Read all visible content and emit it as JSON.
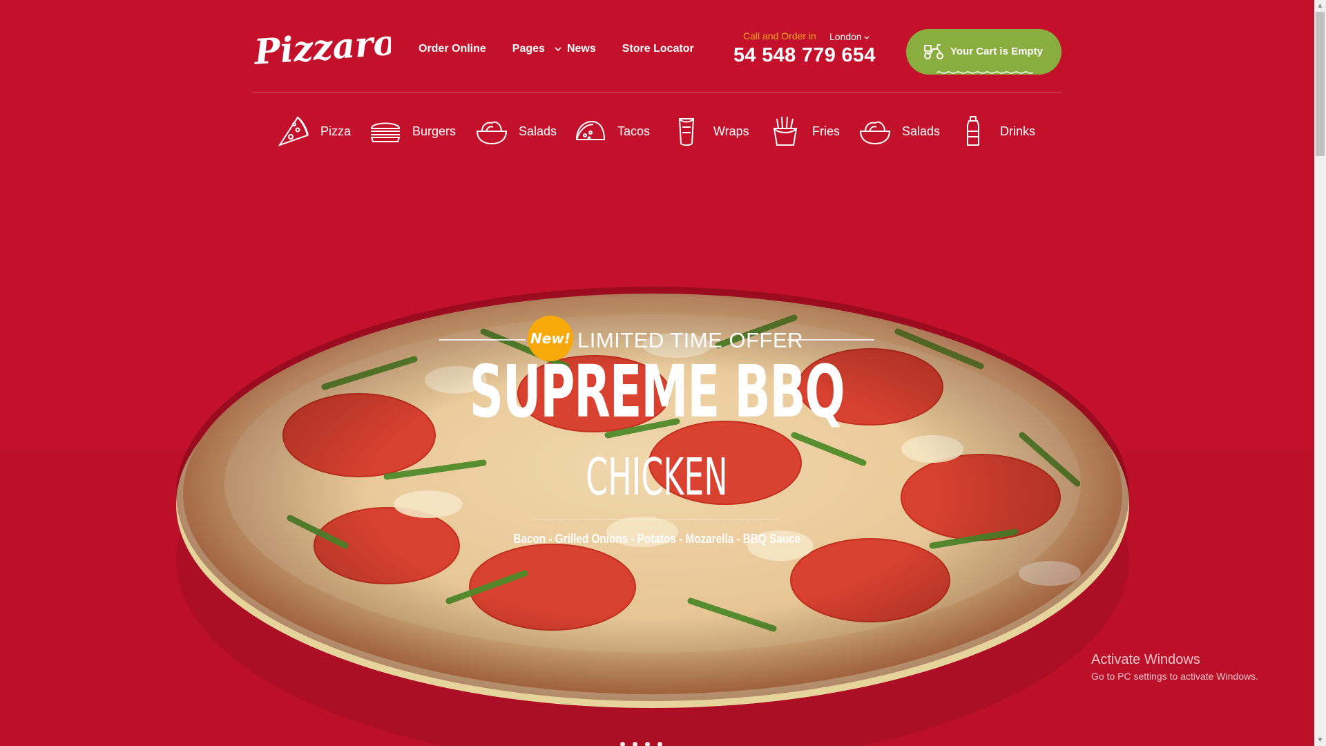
{
  "brand": {
    "logo_text": "Pizzaro"
  },
  "nav": [
    {
      "label": "Order Online"
    },
    {
      "label": "Pages"
    },
    {
      "label": "News"
    },
    {
      "label": "Store Locator"
    }
  ],
  "contact": {
    "call_label": "Call and Order in",
    "city": "London",
    "phone": "54 548 779 654"
  },
  "cart": {
    "label": "Your Cart is Empty"
  },
  "categories": [
    {
      "label": "Pizza",
      "icon": "pizza-slice-icon"
    },
    {
      "label": "Burgers",
      "icon": "burger-icon"
    },
    {
      "label": "Salads",
      "icon": "salad-bowl-icon"
    },
    {
      "label": "Tacos",
      "icon": "taco-icon"
    },
    {
      "label": "Wraps",
      "icon": "wrap-icon"
    },
    {
      "label": "Fries",
      "icon": "fries-icon"
    },
    {
      "label": "Salads",
      "icon": "salad-bowl-icon"
    },
    {
      "label": "Drinks",
      "icon": "drink-bottle-icon"
    }
  ],
  "hero": {
    "badge": "New!",
    "offer": "LIMITED TIME OFFER",
    "title": "SUPREME BBQ",
    "subtitle": "CHICKEN",
    "ingredients": "Bacon - Grilled Onions - Potatos - Mozarella - BBQ Sauce",
    "slides": 4
  },
  "watermark": {
    "title": "Activate Windows",
    "subtitle": "Go to PC settings to activate Windows."
  },
  "colors": {
    "background": "#c3112b",
    "accent_orange": "#f5a623",
    "badge": "#f7a90a",
    "cart_green": "#8aad3f"
  }
}
